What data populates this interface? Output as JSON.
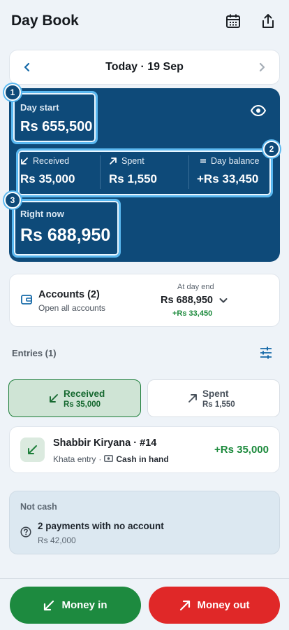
{
  "header": {
    "title": "Day Book",
    "calendar_icon": "calendar-icon",
    "share_icon": "share-icon"
  },
  "date_nav": {
    "label": "Today · 19 Sep",
    "prev_icon": "chevron-left-icon",
    "next_icon": "chevron-right-icon"
  },
  "summary": {
    "badges": [
      "1",
      "2",
      "3"
    ],
    "day_start_label": "Day start",
    "day_start_value": "Rs 655,500",
    "eye_icon": "eye-icon",
    "received_label": "Received",
    "received_value": "Rs 35,000",
    "spent_label": "Spent",
    "spent_value": "Rs 1,550",
    "day_balance_label": "Day balance",
    "day_balance_value": "+Rs 33,450",
    "right_now_label": "Right now",
    "right_now_value": "Rs 688,950",
    "accent_color": "#0e4a79",
    "highlight_color": "#5ab8f0"
  },
  "accounts": {
    "title": "Accounts (2)",
    "subtitle": "Open all accounts",
    "end_label": "At day end",
    "end_value": "Rs 688,950",
    "end_delta": "+Rs 33,450"
  },
  "entries": {
    "label": "Entries (1)",
    "filter_icon": "filter-sliders-icon",
    "tabs": [
      {
        "label": "Received",
        "amount": "Rs 35,000",
        "active": true
      },
      {
        "label": "Spent",
        "amount": "Rs 1,550",
        "active": false
      }
    ],
    "items": [
      {
        "title": "Shabbir Kiryana · #14",
        "type": "Khata entry",
        "account": "Cash in hand",
        "amount": "+Rs 35,000"
      }
    ]
  },
  "not_cash": {
    "title": "Not cash",
    "line": "2 payments with no account",
    "sub": "Rs 42,000"
  },
  "actions": {
    "money_in": "Money in",
    "money_out": "Money out",
    "in_color": "#1d8a3f",
    "out_color": "#e02828"
  }
}
